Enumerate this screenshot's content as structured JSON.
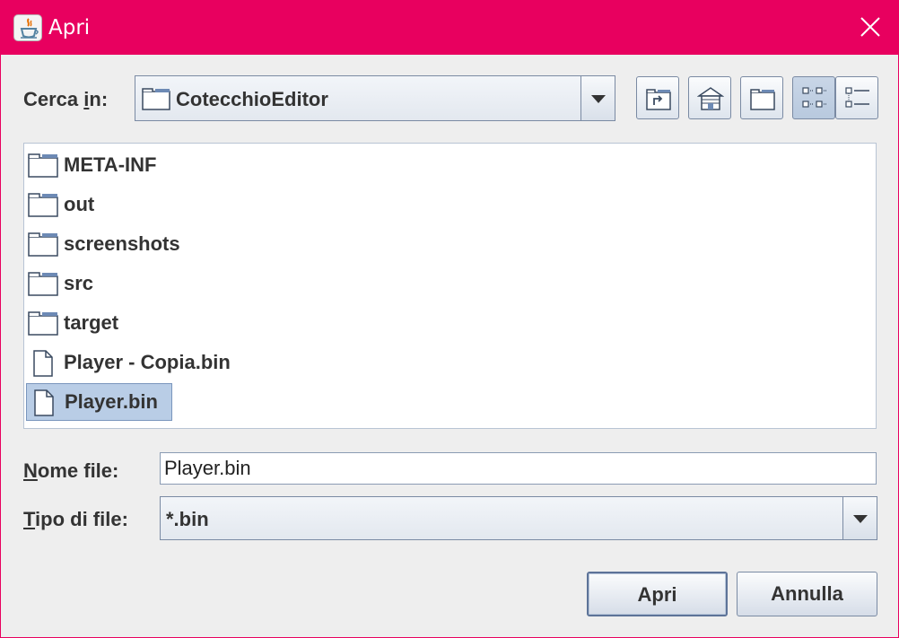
{
  "window": {
    "title": "Apri",
    "app_icon": "java-coffee-icon",
    "close_icon": "close-icon",
    "accent_color": "#e8005f"
  },
  "lookin": {
    "label_pre": "Cerca ",
    "label_mnemonic": "i",
    "label_post": "n:",
    "value": "CotecchioEditor",
    "icon": "folder-icon"
  },
  "toolbar": {
    "buttons": [
      {
        "name": "up-one-level-button",
        "icon": "folder-up-icon"
      },
      {
        "name": "home-button",
        "icon": "home-icon"
      },
      {
        "name": "new-folder-button",
        "icon": "new-folder-icon"
      },
      {
        "name": "list-view-button",
        "icon": "list-view-icon",
        "pressed": true
      },
      {
        "name": "details-view-button",
        "icon": "details-view-icon",
        "pressed": false
      }
    ]
  },
  "files": [
    {
      "name": "META-INF",
      "type": "folder"
    },
    {
      "name": "out",
      "type": "folder"
    },
    {
      "name": "screenshots",
      "type": "folder"
    },
    {
      "name": "src",
      "type": "folder"
    },
    {
      "name": "target",
      "type": "folder"
    },
    {
      "name": "Player - Copia.bin",
      "type": "file"
    },
    {
      "name": "Player.bin",
      "type": "file",
      "selected": true
    }
  ],
  "filename": {
    "label_mnemonic": "N",
    "label_rest": "ome file:",
    "value": "Player.bin"
  },
  "filetype": {
    "label_mnemonic": "T",
    "label_rest": "ipo di file:",
    "value": "*.bin"
  },
  "buttons": {
    "open": "Apri",
    "cancel": "Annulla"
  }
}
